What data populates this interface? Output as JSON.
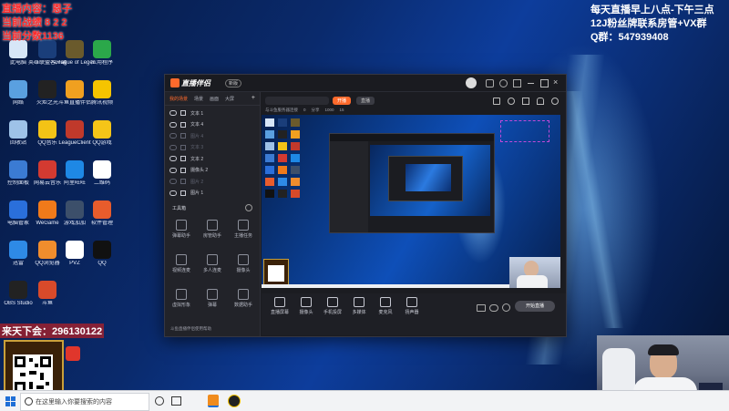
{
  "overlay_left": {
    "line1": "直播内容：恩子",
    "line2": "当前战绩 8 2 2",
    "line3": "当前分数1136",
    "bottom_text": "来天下会：296130122"
  },
  "overlay_right": {
    "line1": "每天直播早上八点-下午三点",
    "line2": "12J粉丝牌联系房管+VX群",
    "line3": "Q群：547939408"
  },
  "desktop_icons": [
    {
      "label": "此电脑",
      "color": "#d7e6f7"
    },
    {
      "label": "英雄联盟客户端",
      "color": "#1a3e7a"
    },
    {
      "label": "League of Legends",
      "color": "#6a5a2c"
    },
    {
      "label": "应用程序",
      "color": "#2ba84a"
    },
    {
      "label": "网络",
      "color": "#5aa0e0"
    },
    {
      "label": "火炬之光",
      "color": "#222222"
    },
    {
      "label": "斗鱼直播伴侣",
      "color": "#f0a020"
    },
    {
      "label": "腾讯视频",
      "color": "#f5c400"
    },
    {
      "label": "回收站",
      "color": "#9ec2e8"
    },
    {
      "label": "QQ音乐",
      "color": "#f3c316"
    },
    {
      "label": "LeagueClient",
      "color": "#c0392b"
    },
    {
      "label": "QQ游戏",
      "color": "#f5c518"
    },
    {
      "label": "控制面板",
      "color": "#3b7bd3"
    },
    {
      "label": "网易云音乐",
      "color": "#d33a31"
    },
    {
      "label": "阿里旺旺",
      "color": "#1e88e5"
    },
    {
      "label": "二维码",
      "color": "#ffffff"
    },
    {
      "label": "电脑管家",
      "color": "#2a6fdb"
    },
    {
      "label": "WeGame",
      "color": "#f07a1a"
    },
    {
      "label": "游戏加加",
      "color": "#3c4f6a"
    },
    {
      "label": "软件管理",
      "color": "#e85c2c"
    },
    {
      "label": "迅雷",
      "color": "#2e8ae6"
    },
    {
      "label": "QQ浏览器",
      "color": "#f08d2d"
    },
    {
      "label": "PVZ",
      "color": "#ffffff"
    },
    {
      "label": "QQ",
      "color": "#111111"
    },
    {
      "label": "OBS Studio",
      "color": "#222222"
    },
    {
      "label": "斗鱼",
      "color": "#d84a2a"
    }
  ],
  "app": {
    "title": "直播伴侣",
    "version": "新版",
    "tabs": [
      "我的场景",
      "场景",
      "画面",
      "大屏"
    ],
    "sources": [
      {
        "name": "文本 1",
        "dim": false
      },
      {
        "name": "文本 4",
        "dim": false
      },
      {
        "name": "图片 4",
        "dim": true
      },
      {
        "name": "文本 3",
        "dim": true
      },
      {
        "name": "文本 2",
        "dim": false
      },
      {
        "name": "摄像头 2",
        "dim": false
      },
      {
        "name": "图片 2",
        "dim": true
      },
      {
        "name": "图片 1",
        "dim": false
      }
    ],
    "toolbox_label": "工具箱",
    "tools": [
      "弹幕助手",
      "房管助手",
      "主播任务",
      "视频连麦",
      "多人连麦",
      "摄像头",
      "虚拟形象",
      "弹幕",
      "数据助手"
    ],
    "search_placeholder": "",
    "live_button": "开播",
    "live_button2": "直播",
    "status_bar": [
      "与斗鱼服务器连接",
      "0",
      "分享",
      "1000",
      "15"
    ],
    "bottom_buttons": [
      "直播屏幕",
      "摄像头",
      "手机投屏",
      "多媒体",
      "麦克风",
      "扬声器"
    ],
    "start_button": "开始直播",
    "footer_text": "斗鱼直播伴侣使用帮助"
  },
  "colors": {
    "overlay_red": "#ff2a2a",
    "overlay_white": "#ffffff",
    "accent_orange": "#ff6a2c"
  },
  "taskbar": {
    "search_placeholder": "在这里输入你要搜索的内容"
  }
}
